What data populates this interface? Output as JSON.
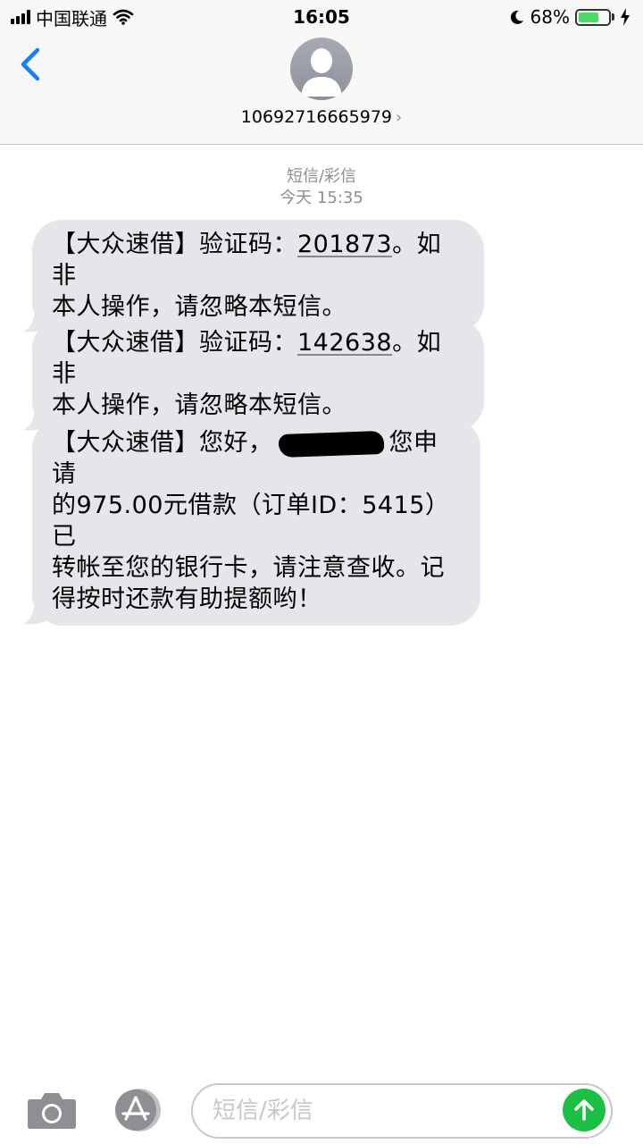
{
  "status_bar": {
    "carrier": "中国联通",
    "time": "16:05",
    "battery_percent": "68%",
    "battery_level": 0.68,
    "icons": [
      "signal-icon",
      "wifi-icon",
      "moon-icon",
      "battery-icon",
      "charging-bolt-icon"
    ]
  },
  "header": {
    "back_icon": "chevron-left-icon",
    "avatar_icon": "person-silhouette-icon",
    "contact_number": "10692716665979",
    "contact_chevron": "›"
  },
  "conversation": {
    "message_type": "短信/彩信",
    "timestamp": "今天 15:35",
    "messages": [
      {
        "line1_a": "【大众速借】验证码：",
        "line1_code": "201873",
        "line1_b": "。如非",
        "line2": "本人操作，请忽略本短信。"
      },
      {
        "line1_a": "【大众速借】验证码：",
        "line1_code": "142638",
        "line1_b": "。如非",
        "line2": "本人操作，请忽略本短信。"
      },
      {
        "line1_a": "【大众速借】您好，",
        "line1_b": "您申请",
        "line2": "的975.00元借款（订单ID：5415）已",
        "line3": "转帐至您的银行卡，请注意查收。记",
        "line4": "得按时还款有助提额哟！"
      }
    ]
  },
  "input_bar": {
    "placeholder": "短信/彩信",
    "camera_icon": "camera-icon",
    "appstore_icon": "app-store-icon",
    "send_icon": "send-arrow-up-icon",
    "send_color": "#1bbf43"
  }
}
